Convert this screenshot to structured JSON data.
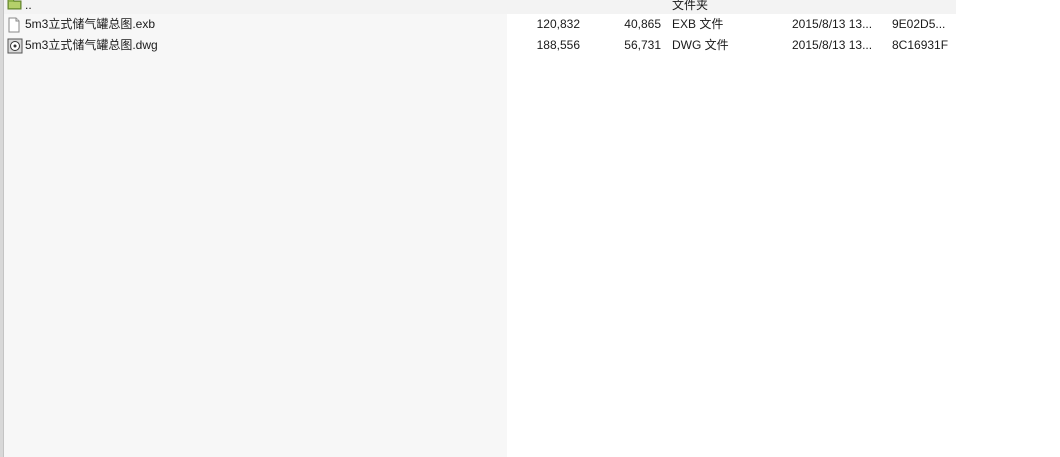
{
  "file_list": {
    "parent_row": {
      "name": "..",
      "type": "文件夹",
      "icon": "folder-up-icon"
    },
    "rows": [
      {
        "name": "5m3立式储气罐总图.exb",
        "size": "120,832",
        "packed": "40,865",
        "type": "EXB 文件",
        "modified": "2015/8/13 13...",
        "crc": "9E02D5...",
        "icon": "document-icon"
      },
      {
        "name": "5m3立式储气罐总图.dwg",
        "size": "188,556",
        "packed": "56,731",
        "type": "DWG 文件",
        "modified": "2015/8/13 13...",
        "crc": "8C16931F",
        "icon": "dwg-file-icon"
      }
    ]
  }
}
